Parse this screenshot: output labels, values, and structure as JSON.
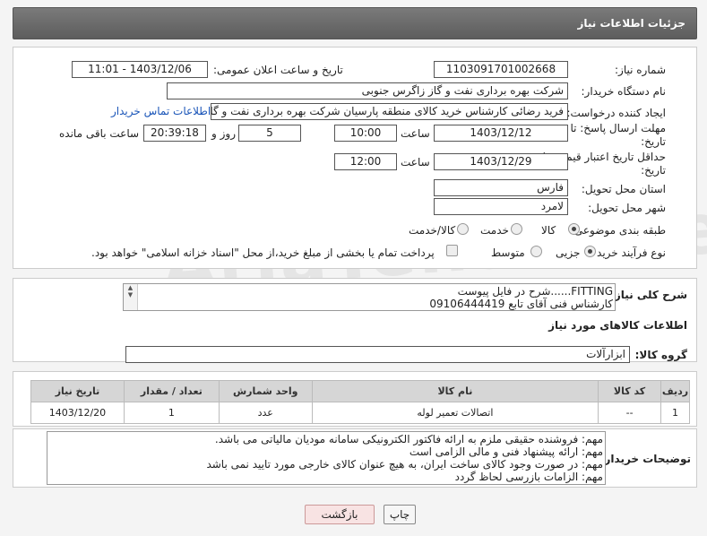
{
  "header": {
    "title": "جزئیات اطلاعات نیاز"
  },
  "form": {
    "need_number": {
      "label": "شماره نیاز:",
      "value": "1103091701002668"
    },
    "announce_datetime": {
      "label": "تاریخ و ساعت اعلان عمومی:",
      "value": "1403/12/06 - 11:01"
    },
    "buyer_org": {
      "label": "نام دستگاه خریدار:",
      "value": "شرکت بهره برداری نفت و گاز زاگرس جنوبی"
    },
    "requester": {
      "label": "ایجاد کننده درخواست:",
      "value": "فرید رضائی کارشناس خرید کالای منطقه پارسیان شرکت بهره برداری نفت و گاز",
      "contact_link": "اطلاعات تماس خریدار"
    },
    "reply_deadline": {
      "label": "مهلت ارسال پاسخ: تا تاریخ:",
      "date": "1403/12/12",
      "time_label": "ساعت",
      "time": "10:00",
      "days": "5",
      "days_label": "روز و",
      "remaining": "20:39:18",
      "remaining_label": "ساعت باقی مانده"
    },
    "price_validity": {
      "label": "حداقل تاریخ اعتبار قیمت: تا تاریخ:",
      "date": "1403/12/29",
      "time_label": "ساعت",
      "time": "12:00"
    },
    "province": {
      "label": "استان محل تحویل:",
      "value": "فارس"
    },
    "city": {
      "label": "شهر محل تحویل:",
      "value": "لامرد"
    },
    "category": {
      "label": "طبقه بندی موضوعی:",
      "options": [
        "کالا",
        "خدمت",
        "کالا/خدمت"
      ],
      "selected": "کالا"
    },
    "purchase_type": {
      "label": "نوع فرآیند خرید :",
      "options": [
        "جزیی",
        "متوسط"
      ],
      "payment_note": "پرداخت تمام یا بخشی از مبلغ خرید،از محل \"اسناد خزانه اسلامی\" خواهد بود."
    }
  },
  "description": {
    "label": "شرح کلی نیاز:",
    "line1": "FITTING......شرح در فایل پیوست",
    "line2": "کارشناس فنی آقای تابع 09106444419"
  },
  "goods_info": {
    "title": "اطلاعات کالاهای مورد نیاز",
    "group_label": "گروه کالا:",
    "group_value": "ابزارآلات"
  },
  "table": {
    "headers": [
      "ردیف",
      "کد کالا",
      "نام کالا",
      "واحد شمارش",
      "تعداد / مقدار",
      "تاریخ نیاز"
    ],
    "rows": [
      {
        "row": "1",
        "code": "--",
        "name": "اتصالات تعمیر لوله",
        "unit": "عدد",
        "qty": "1",
        "date": "1403/12/20"
      }
    ]
  },
  "buyer_notes": {
    "label": "توضیحات خریدار:",
    "lines": [
      "مهم: فروشنده حقیقی ملزم به ارائه فاکتور الکترونیکی سامانه مودیان مالیاتی می باشد.",
      "مهم: ارائه پیشنهاد فنی و مالی الزامی است",
      "مهم: در صورت وجود کالای ساخت ایران، به هیچ عنوان کالای خارجی مورد تایید نمی باشد",
      "مهم: الزامات بازرسی لحاظ گردد"
    ]
  },
  "buttons": {
    "print": "چاپ",
    "back": "بازگشت"
  },
  "watermark": "AriaTender.neT"
}
